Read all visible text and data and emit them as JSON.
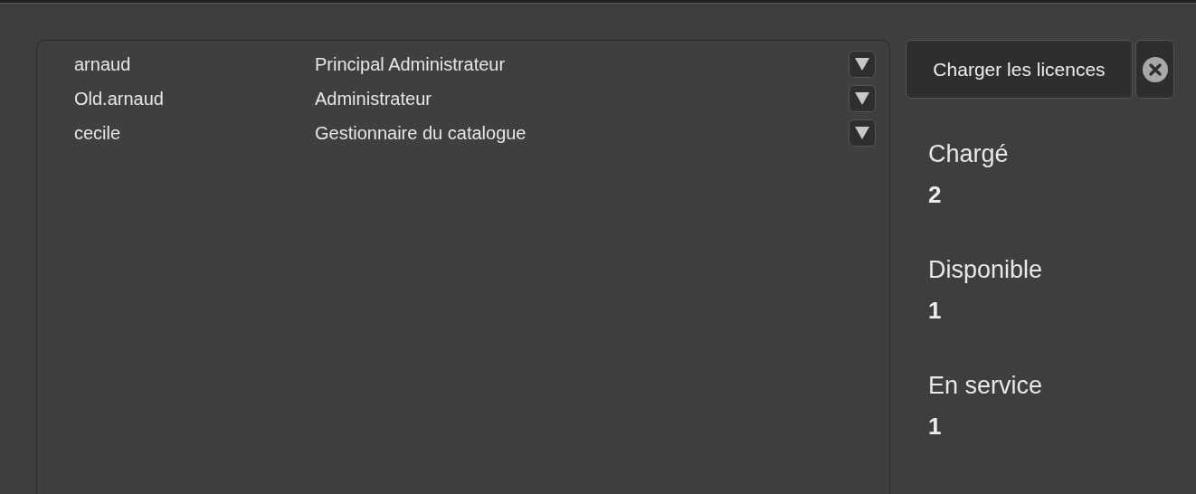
{
  "users": [
    {
      "name": "arnaud",
      "role": "Principal Administrateur"
    },
    {
      "name": "Old.arnaud",
      "role": "Administrateur"
    },
    {
      "name": "cecile",
      "role": "Gestionnaire du catalogue"
    }
  ],
  "load_button": "Charger les licences",
  "stats": [
    {
      "label": "Chargé",
      "value": "2"
    },
    {
      "label": "Disponible",
      "value": "1"
    },
    {
      "label": "En service",
      "value": "1"
    }
  ]
}
